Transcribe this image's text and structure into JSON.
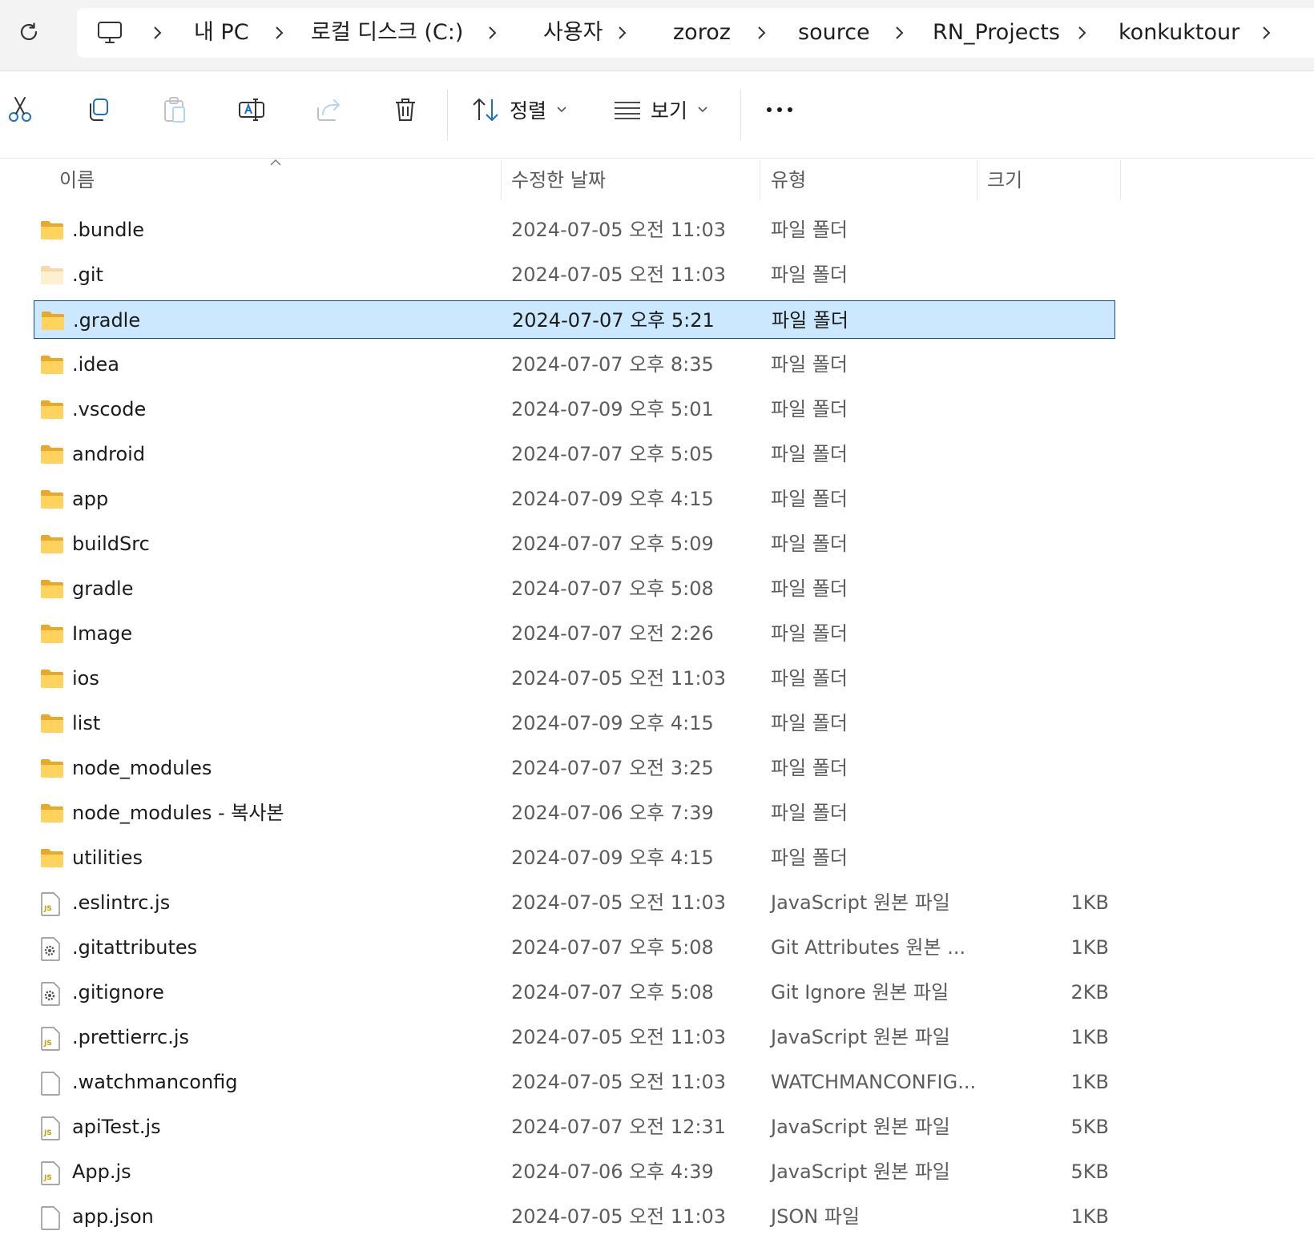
{
  "address": {
    "crumbs": [
      "내 PC",
      "로컬 디스크 (C:)",
      "사용자",
      "zoroz",
      "source",
      "RN_Projects",
      "konkuktour"
    ]
  },
  "toolbar": {
    "sort_label": "정렬",
    "view_label": "보기"
  },
  "columns": {
    "name": "이름",
    "date": "수정한 날짜",
    "type": "유형",
    "size": "크기"
  },
  "files": [
    {
      "name": ".bundle",
      "date": "2024-07-05 오전 11:03",
      "type": "파일 폴더",
      "size": "",
      "icon": "folder-icon"
    },
    {
      "name": ".git",
      "date": "2024-07-05 오전 11:03",
      "type": "파일 폴더",
      "size": "",
      "icon": "folder-hidden-icon"
    },
    {
      "name": ".gradle",
      "date": "2024-07-07 오후 5:21",
      "type": "파일 폴더",
      "size": "",
      "icon": "folder-icon",
      "selected": true
    },
    {
      "name": ".idea",
      "date": "2024-07-07 오후 8:35",
      "type": "파일 폴더",
      "size": "",
      "icon": "folder-icon"
    },
    {
      "name": ".vscode",
      "date": "2024-07-09 오후 5:01",
      "type": "파일 폴더",
      "size": "",
      "icon": "folder-icon"
    },
    {
      "name": "android",
      "date": "2024-07-07 오후 5:05",
      "type": "파일 폴더",
      "size": "",
      "icon": "folder-icon"
    },
    {
      "name": "app",
      "date": "2024-07-09 오후 4:15",
      "type": "파일 폴더",
      "size": "",
      "icon": "folder-icon"
    },
    {
      "name": "buildSrc",
      "date": "2024-07-07 오후 5:09",
      "type": "파일 폴더",
      "size": "",
      "icon": "folder-icon"
    },
    {
      "name": "gradle",
      "date": "2024-07-07 오후 5:08",
      "type": "파일 폴더",
      "size": "",
      "icon": "folder-icon"
    },
    {
      "name": "Image",
      "date": "2024-07-07 오전 2:26",
      "type": "파일 폴더",
      "size": "",
      "icon": "folder-icon"
    },
    {
      "name": "ios",
      "date": "2024-07-05 오전 11:03",
      "type": "파일 폴더",
      "size": "",
      "icon": "folder-icon"
    },
    {
      "name": "list",
      "date": "2024-07-09 오후 4:15",
      "type": "파일 폴더",
      "size": "",
      "icon": "folder-icon"
    },
    {
      "name": "node_modules",
      "date": "2024-07-07 오전 3:25",
      "type": "파일 폴더",
      "size": "",
      "icon": "folder-icon"
    },
    {
      "name": "node_modules - 복사본",
      "date": "2024-07-06 오후 7:39",
      "type": "파일 폴더",
      "size": "",
      "icon": "folder-icon"
    },
    {
      "name": "utilities",
      "date": "2024-07-09 오후 4:15",
      "type": "파일 폴더",
      "size": "",
      "icon": "folder-icon"
    },
    {
      "name": ".eslintrc.js",
      "date": "2024-07-05 오전 11:03",
      "type": "JavaScript 원본 파일",
      "size": "1KB",
      "icon": "js-file-icon"
    },
    {
      "name": ".gitattributes",
      "date": "2024-07-07 오후 5:08",
      "type": "Git Attributes 원본 ...",
      "size": "1KB",
      "icon": "config-file-icon"
    },
    {
      "name": ".gitignore",
      "date": "2024-07-07 오후 5:08",
      "type": "Git Ignore 원본 파일",
      "size": "2KB",
      "icon": "config-file-icon"
    },
    {
      "name": ".prettierrc.js",
      "date": "2024-07-05 오전 11:03",
      "type": "JavaScript 원본 파일",
      "size": "1KB",
      "icon": "js-file-icon"
    },
    {
      "name": ".watchmanconfig",
      "date": "2024-07-05 오전 11:03",
      "type": "WATCHMANCONFIG...",
      "size": "1KB",
      "icon": "blank-file-icon"
    },
    {
      "name": "apiTest.js",
      "date": "2024-07-07 오전 12:31",
      "type": "JavaScript 원본 파일",
      "size": "5KB",
      "icon": "js-file-icon"
    },
    {
      "name": "App.js",
      "date": "2024-07-06 오후 4:39",
      "type": "JavaScript 원본 파일",
      "size": "5KB",
      "icon": "js-file-icon"
    },
    {
      "name": "app.json",
      "date": "2024-07-05 오전 11:03",
      "type": "JSON 파일",
      "size": "1KB",
      "icon": "blank-file-icon"
    }
  ]
}
